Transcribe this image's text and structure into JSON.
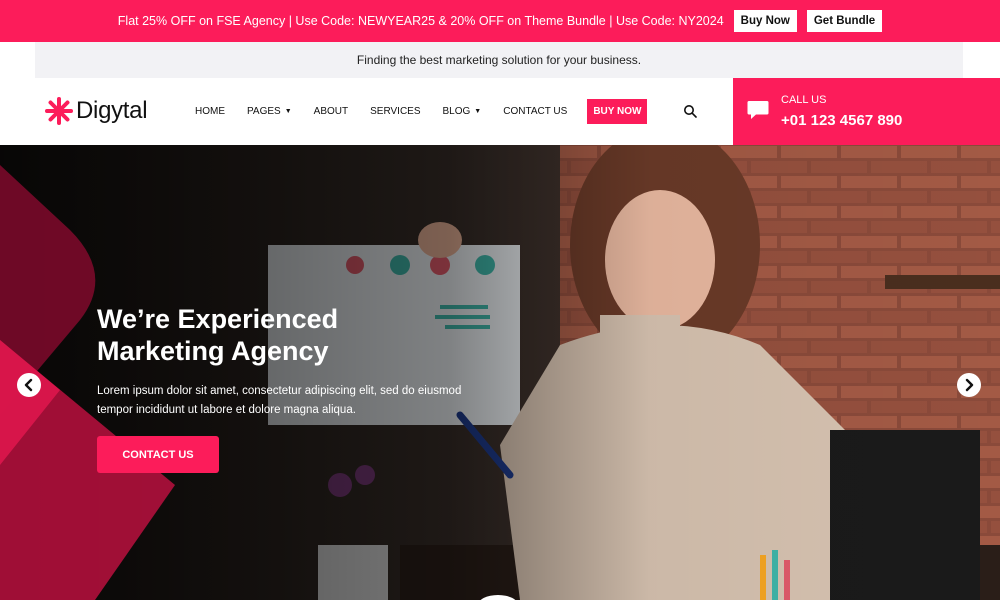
{
  "promo": {
    "text": "Flat 25% OFF on FSE Agency | Use Code: NEWYEAR25 & 20% OFF on Theme Bundle | Use Code: NY2024",
    "buy_now_label": "Buy Now",
    "get_bundle_label": "Get Bundle"
  },
  "tagline": "Finding the best marketing solution for your business.",
  "header": {
    "logo_text": "Digytal",
    "nav": {
      "home": "HOME",
      "pages": "PAGES",
      "about": "ABOUT",
      "services": "SERVICES",
      "blog": "BLOG",
      "contact": "CONTACT US"
    },
    "buy_now": "BUY NOW",
    "call_label": "CALL US",
    "call_number": "+01 123 4567 890"
  },
  "hero": {
    "title": "We’re Experienced Marketing Agency",
    "description": "Lorem ipsum dolor sit amet, consectetur adipiscing elit, sed do eiusmod tempor incididunt ut labore et dolore magna aliqua.",
    "cta_label": "CONTACT US"
  },
  "icons": {
    "logo": "asterisk-logo-icon",
    "search": "search-icon",
    "call": "chat-bubble-icon",
    "prev": "arrow-left-icon",
    "next": "arrow-right-icon",
    "dropdown": "caret-down-icon"
  },
  "colors": {
    "accent": "#fc1c5a",
    "dark_accent": "#8b0a2c",
    "text": "#111111"
  }
}
